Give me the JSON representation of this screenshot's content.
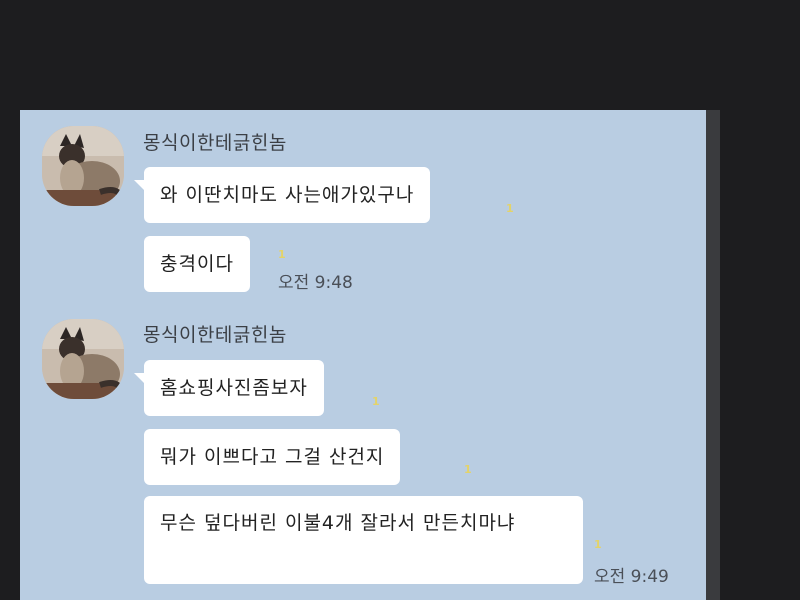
{
  "messages_group1": {
    "sender": "몽식이한테긁힌놈",
    "bubbles": [
      "와 이딴치마도 사는애가있구나",
      "충격이다"
    ],
    "unread": [
      "1",
      "1"
    ],
    "time": "오전 9:48"
  },
  "messages_group2": {
    "sender": "몽식이한테긁힌놈",
    "bubbles": [
      "홈쇼핑사진좀보자",
      "뭐가 이쁘다고 그걸 산건지",
      "무슨 덮다버린 이불4개 잘라서 만든치마냐"
    ],
    "unread": [
      "1",
      "1",
      "1"
    ],
    "time": "오전 9:49"
  },
  "colors": {
    "chat_background": "#b9cde2",
    "outer_background": "#1d1d1f",
    "bubble": "#ffffff",
    "unread_count": "#e3d36a"
  },
  "icons": {
    "avatar": "cat-avatar"
  }
}
